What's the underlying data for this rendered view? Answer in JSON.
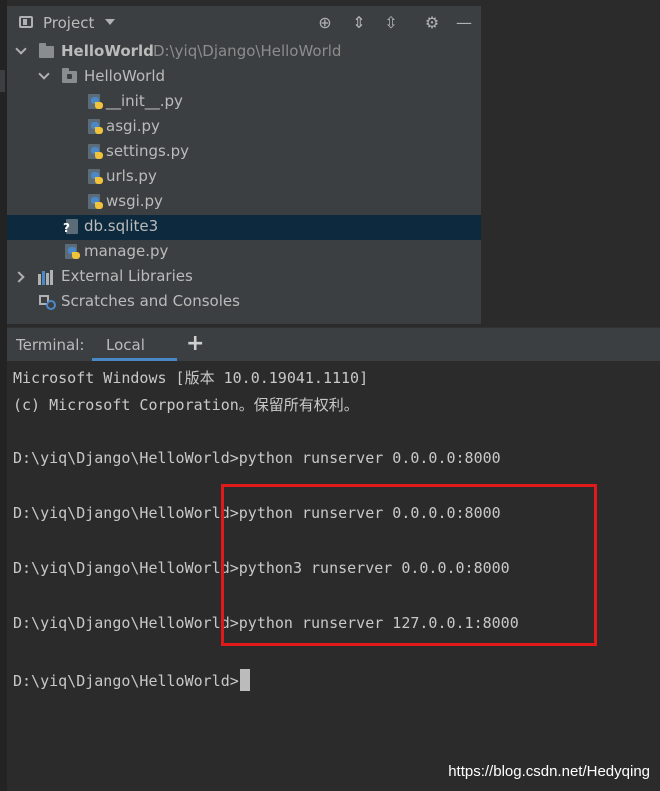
{
  "project_panel": {
    "title": "Project",
    "root": {
      "name": "HelloWorld",
      "path": "D:\\yiq\\Django\\HelloWorld"
    },
    "package": {
      "name": "HelloWorld"
    },
    "package_files": [
      "__init__.py",
      "asgi.py",
      "settings.py",
      "urls.py",
      "wsgi.py"
    ],
    "root_files": [
      {
        "name": "db.sqlite3",
        "icon": "unknown-file-icon",
        "selected": true
      },
      {
        "name": "manage.py",
        "icon": "python-file-icon",
        "selected": false
      }
    ],
    "external_libraries": "External Libraries",
    "scratches": "Scratches and Consoles"
  },
  "terminal": {
    "label": "Terminal:",
    "tab": "Local",
    "add_tab": "+",
    "lines": [
      "Microsoft Windows [版本 10.0.19041.1110]",
      "(c) Microsoft Corporation。保留所有权利。",
      "",
      "D:\\yiq\\Django\\HelloWorld>python runserver 0.0.0.0:8000",
      "",
      "D:\\yiq\\Django\\HelloWorld>python runserver 0.0.0.0:8000",
      "",
      "D:\\yiq\\Django\\HelloWorld>python3 runserver 0.0.0.0:8000",
      "",
      "D:\\yiq\\Django\\HelloWorld>python runserver 127.0.0.1:8000",
      "",
      "D:\\yiq\\Django\\HelloWorld>"
    ]
  },
  "watermark": "https://blog.csdn.net/Hedyqing",
  "colors": {
    "selection": "#0d293e",
    "tab_underline": "#4a88c7",
    "highlight_box": "#e01a1a"
  }
}
